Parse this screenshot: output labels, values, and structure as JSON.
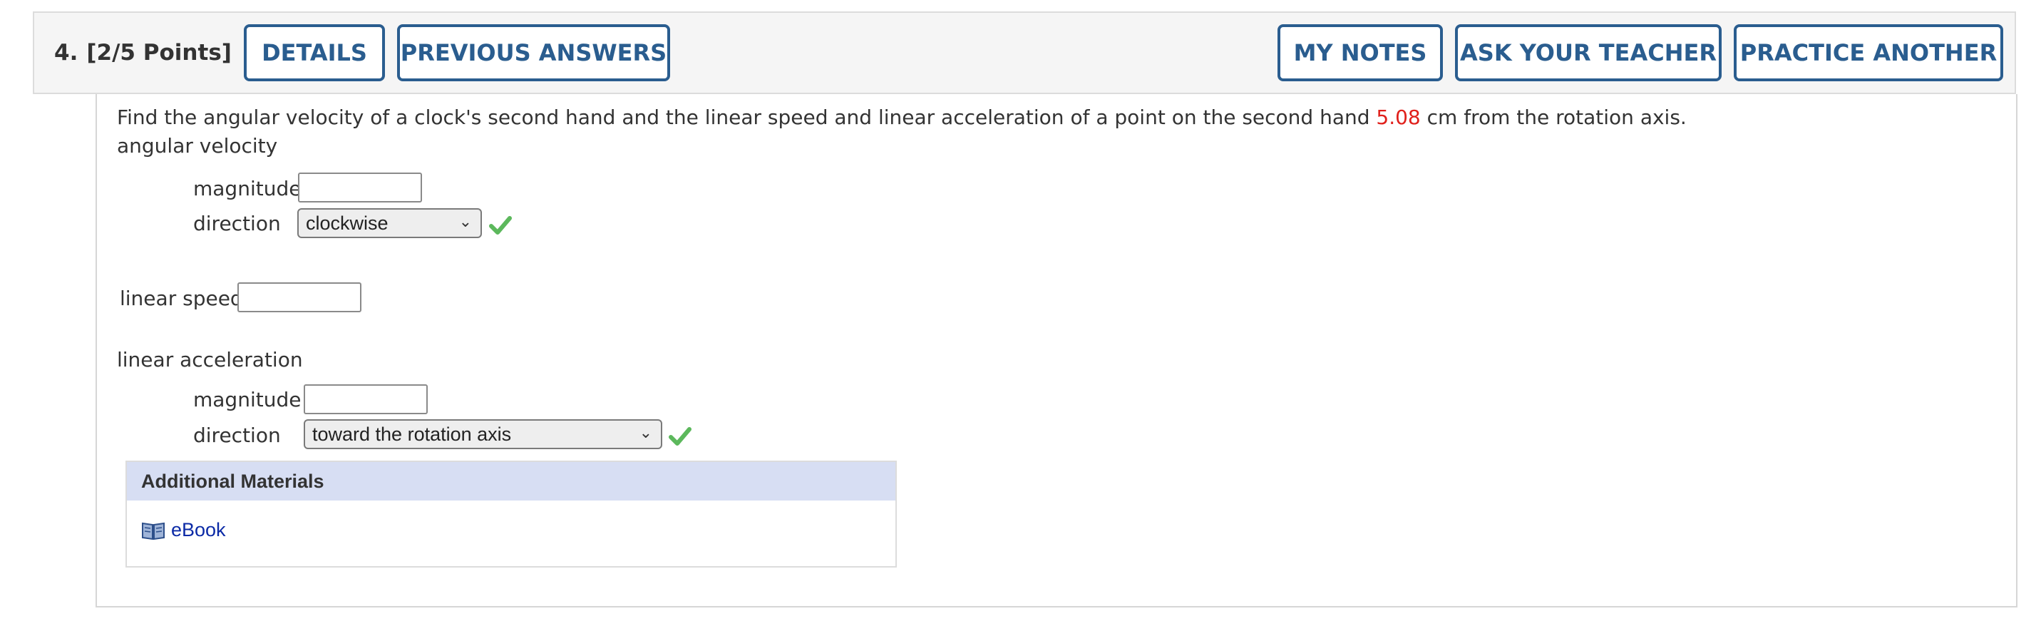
{
  "header": {
    "question_number": "4.",
    "points": "[2/5 Points]",
    "buttons": {
      "details": "DETAILS",
      "previous_answers": "PREVIOUS ANSWERS",
      "my_notes": "MY NOTES",
      "ask_teacher": "ASK YOUR TEACHER",
      "practice_another": "PRACTICE ANOTHER"
    }
  },
  "question": {
    "prompt_before": "Find the angular velocity of a clock's second hand and the linear speed and linear acceleration of a point on the second hand ",
    "highlight_value": "5.08",
    "prompt_after": " cm from the rotation axis.",
    "angular_velocity_heading": "angular velocity",
    "av_magnitude_label": "magnitude",
    "av_magnitude_value": "",
    "av_direction_label": "direction",
    "av_direction_selected": "clockwise",
    "linear_speed_label": "linear speed",
    "linear_speed_value": "",
    "linear_accel_heading": "linear acceleration",
    "la_magnitude_label": "magnitude",
    "la_magnitude_value": "",
    "la_direction_label": "direction",
    "la_direction_selected": "toward the rotation axis"
  },
  "additional_materials": {
    "title": "Additional Materials",
    "ebook_label": "eBook"
  },
  "colors": {
    "accent": "#2a5d8f",
    "highlight": "#e0201b",
    "correct": "#5cb85c",
    "materials_header": "#d7def3"
  },
  "icons": [
    "checkmark-icon",
    "book-icon",
    "chevron-down-icon"
  ]
}
